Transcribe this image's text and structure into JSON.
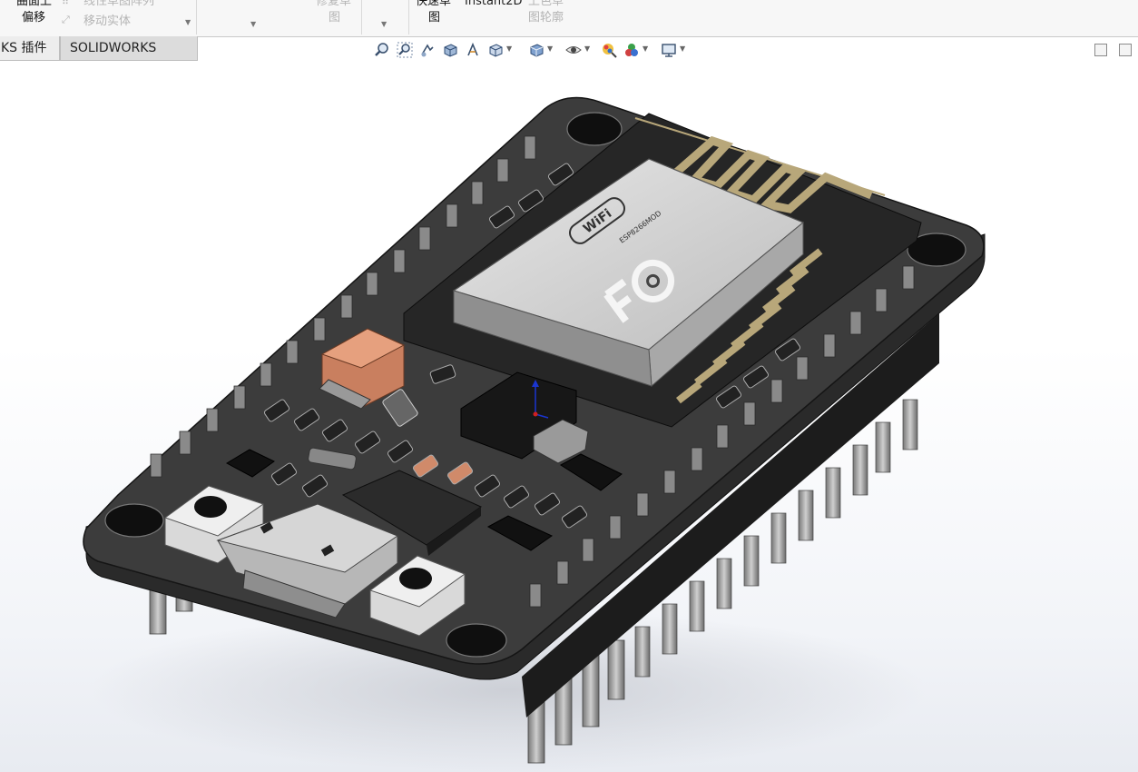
{
  "ribbon": {
    "offset_surface_label_1": "曲面上",
    "offset_surface_label_2": "偏移",
    "linear_sketch_pattern": "线性草图阵列",
    "move_entities": "移动实体",
    "repair_sketch_label_1": "修复草",
    "repair_sketch_label_2": "图",
    "rapid_sketch_label_1": "快速草",
    "rapid_sketch_label_2": "图",
    "instant2d": "Instant2D",
    "shaded_sketch_label_1": "上色草",
    "shaded_sketch_label_2": "图轮廓"
  },
  "tabs": [
    {
      "label": "KS 插件"
    },
    {
      "label": "SOLIDWORKS MBD"
    }
  ],
  "view_toolbar": {
    "icons": [
      "zoom-to-fit-icon",
      "zoom-to-area-icon",
      "previous-view-icon",
      "section-view-icon",
      "dynamic-annotation-icon",
      "view-orientation-icon",
      "display-style-icon",
      "hide-show-items-icon",
      "edit-appearance-icon",
      "apply-scene-icon",
      "view-settings-icon"
    ]
  },
  "colors": {
    "pcb": "#3a3a3a",
    "module_shield": "#c9c9c9",
    "copper_pad": "#b8a77a",
    "header_pin": "#9a9a9a",
    "accent_component": "#e6a07e"
  },
  "model": {
    "shield_logo_text": "WiFi",
    "shield_model_text": "ESP8266MOD"
  }
}
